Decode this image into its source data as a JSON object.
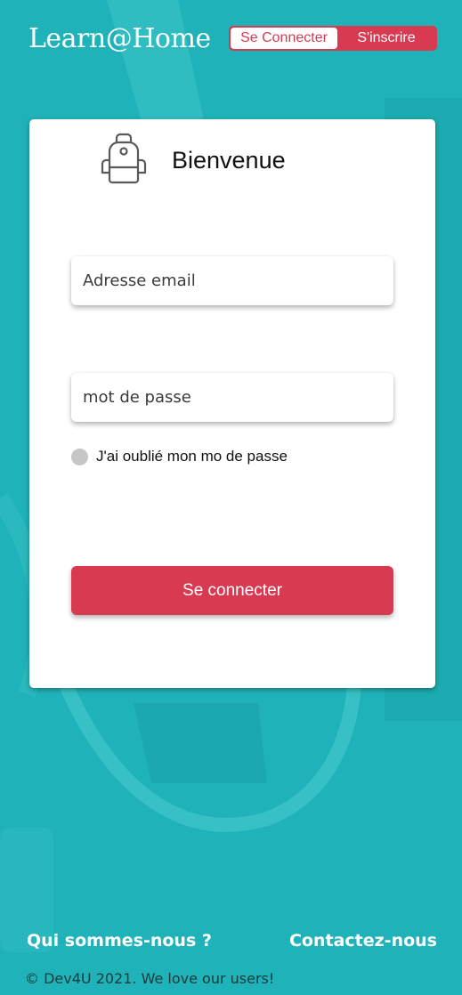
{
  "header": {
    "logo": "Learn@Home",
    "login_tab": "Se Connecter",
    "signup_tab": "S'inscrire"
  },
  "card": {
    "icon": "backpack-icon",
    "title": "Bienvenue",
    "email_placeholder": "Adresse email",
    "password_placeholder": "mot de passe",
    "forgot_label": "J'ai oublié mon mo de passe",
    "submit_label": "Se connecter"
  },
  "footer": {
    "about": "Qui sommes-nous ?",
    "contact": "Contactez-nous",
    "copyright": "© Dev4U 2021. We love our users!"
  },
  "colors": {
    "background": "#1fb3b9",
    "accent": "#d83a52",
    "card": "#ffffff"
  }
}
